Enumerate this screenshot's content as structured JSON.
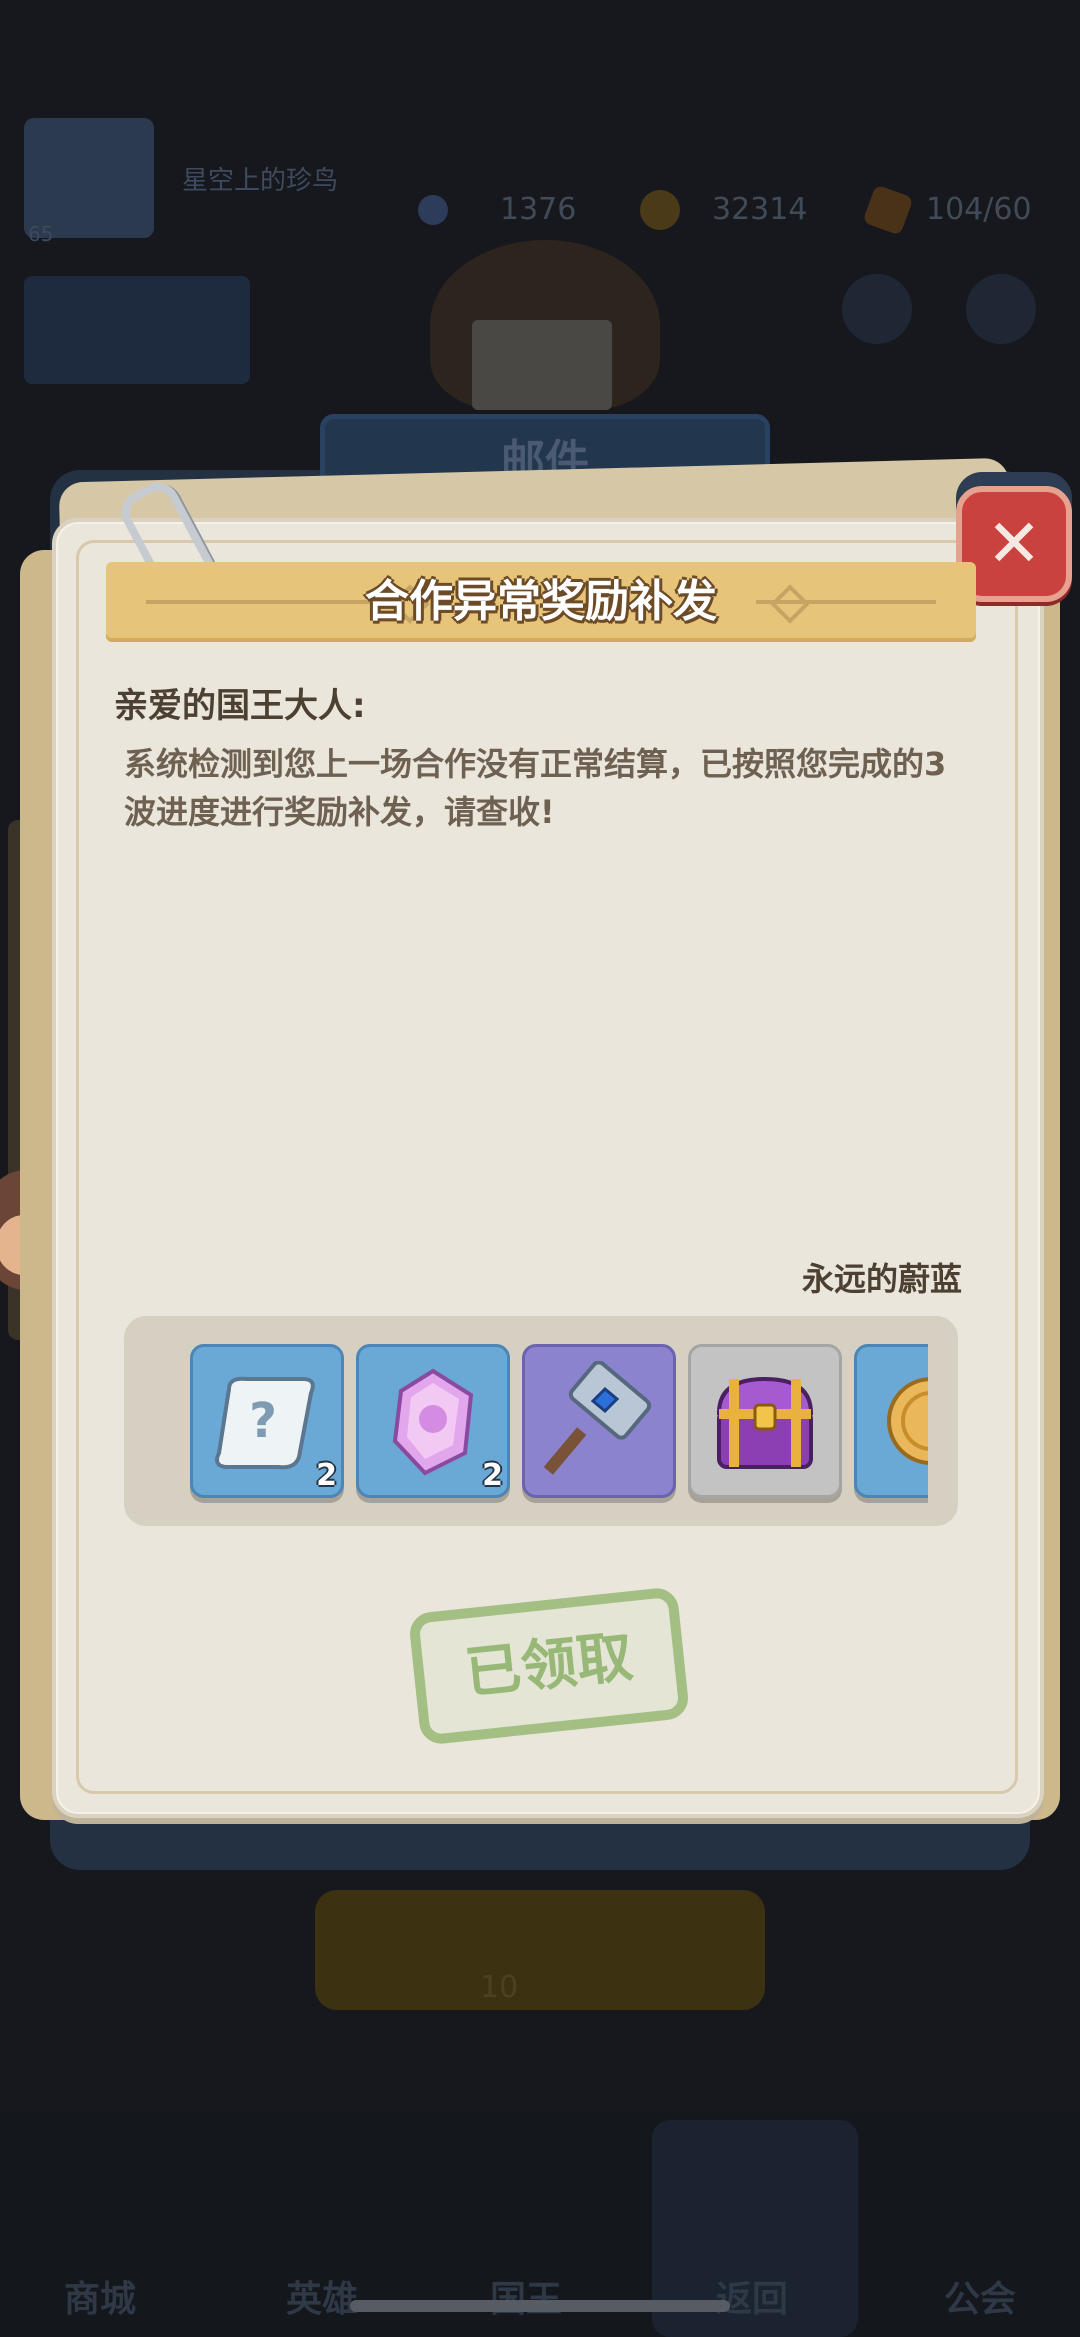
{
  "background": {
    "player_name": "星空上的珍鸟",
    "player_level": "65",
    "resources": {
      "gems": "1376",
      "gold": "32314",
      "stamina": "104/60"
    },
    "mail_banner_title": "邮件",
    "button_text": "10",
    "nav_items": [
      "商城",
      "英雄",
      "国王",
      "返回",
      "公会"
    ]
  },
  "mail": {
    "title": "合作异常奖励补发",
    "greeting": "亲爱的国王大人:",
    "body": "系统检测到您上一场合作没有正常结算，已按照您完成的3波进度进行奖励补发，请查收!",
    "signature": "永远的蔚蓝",
    "rewards": [
      {
        "icon": "mystery-scroll-icon",
        "count": "2",
        "frame": "blue"
      },
      {
        "icon": "pink-crystal-icon",
        "count": "2",
        "frame": "blue"
      },
      {
        "icon": "crystal-hammer-icon",
        "count": "",
        "frame": "purple"
      },
      {
        "icon": "treasure-chest-icon",
        "count": "",
        "frame": "grey"
      },
      {
        "icon": "gold-coin-icon",
        "count": "",
        "frame": "blue"
      }
    ],
    "claimed_label": "已领取",
    "close_icon": "close-icon"
  },
  "colors": {
    "paper": "#eae6dc",
    "ribbon": "#e6c57a",
    "close": "#c9423f",
    "stamp": "#a4bf83"
  }
}
